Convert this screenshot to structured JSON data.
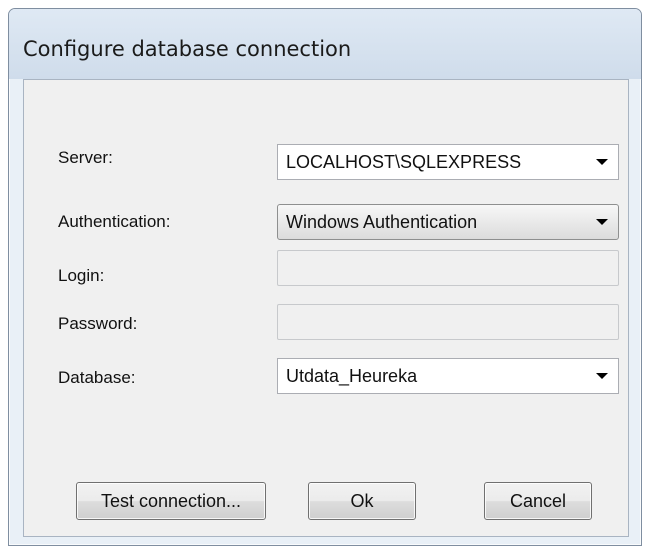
{
  "window": {
    "title": "Configure database connection"
  },
  "form": {
    "server": {
      "label": "Server:",
      "value": "LOCALHOST\\SQLEXPRESS"
    },
    "authentication": {
      "label": "Authentication:",
      "value": "Windows Authentication"
    },
    "login": {
      "label": "Login:",
      "value": ""
    },
    "password": {
      "label": "Password:",
      "value": ""
    },
    "database": {
      "label": "Database:",
      "value": "Utdata_Heureka"
    }
  },
  "buttons": {
    "test_connection": "Test connection...",
    "ok": "Ok",
    "cancel": "Cancel"
  },
  "icons": {
    "dropdown": "chevron-down-icon"
  }
}
